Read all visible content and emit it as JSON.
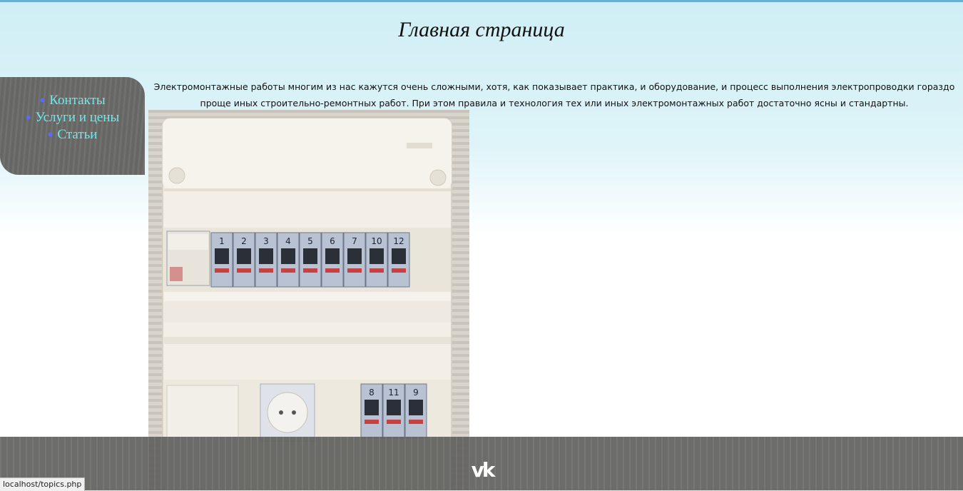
{
  "page": {
    "title": "Главная страница",
    "intro": "Электромонтажные работы многим из нас кажутся очень сложными, хотя, как показывает практика, и оборудование, и процесс выполнения электропроводки гораздо проще иных строительно-ремонтных работ. При этом правила и технология тех или иных электромонтажных работ достаточно ясны и стандартны."
  },
  "nav": {
    "items": [
      {
        "label": "Контакты"
      },
      {
        "label": "Услуги и цены"
      },
      {
        "label": "Статьи"
      }
    ]
  },
  "photo": {
    "breaker_labels_top": [
      "1",
      "2",
      "3",
      "4",
      "5",
      "6",
      "7",
      "10",
      "12"
    ],
    "breaker_labels_bottom": [
      "8",
      "11",
      "9"
    ]
  },
  "footer": {
    "social_icon": "vk-icon",
    "social_text": "vk"
  },
  "statusbar": {
    "url": "localhost/topics.php"
  },
  "colors": {
    "nav_bg": "#6a6b69",
    "nav_link": "#6fe9ec",
    "nav_bullet": "#5b6bff",
    "footer_bg": "#646462"
  }
}
